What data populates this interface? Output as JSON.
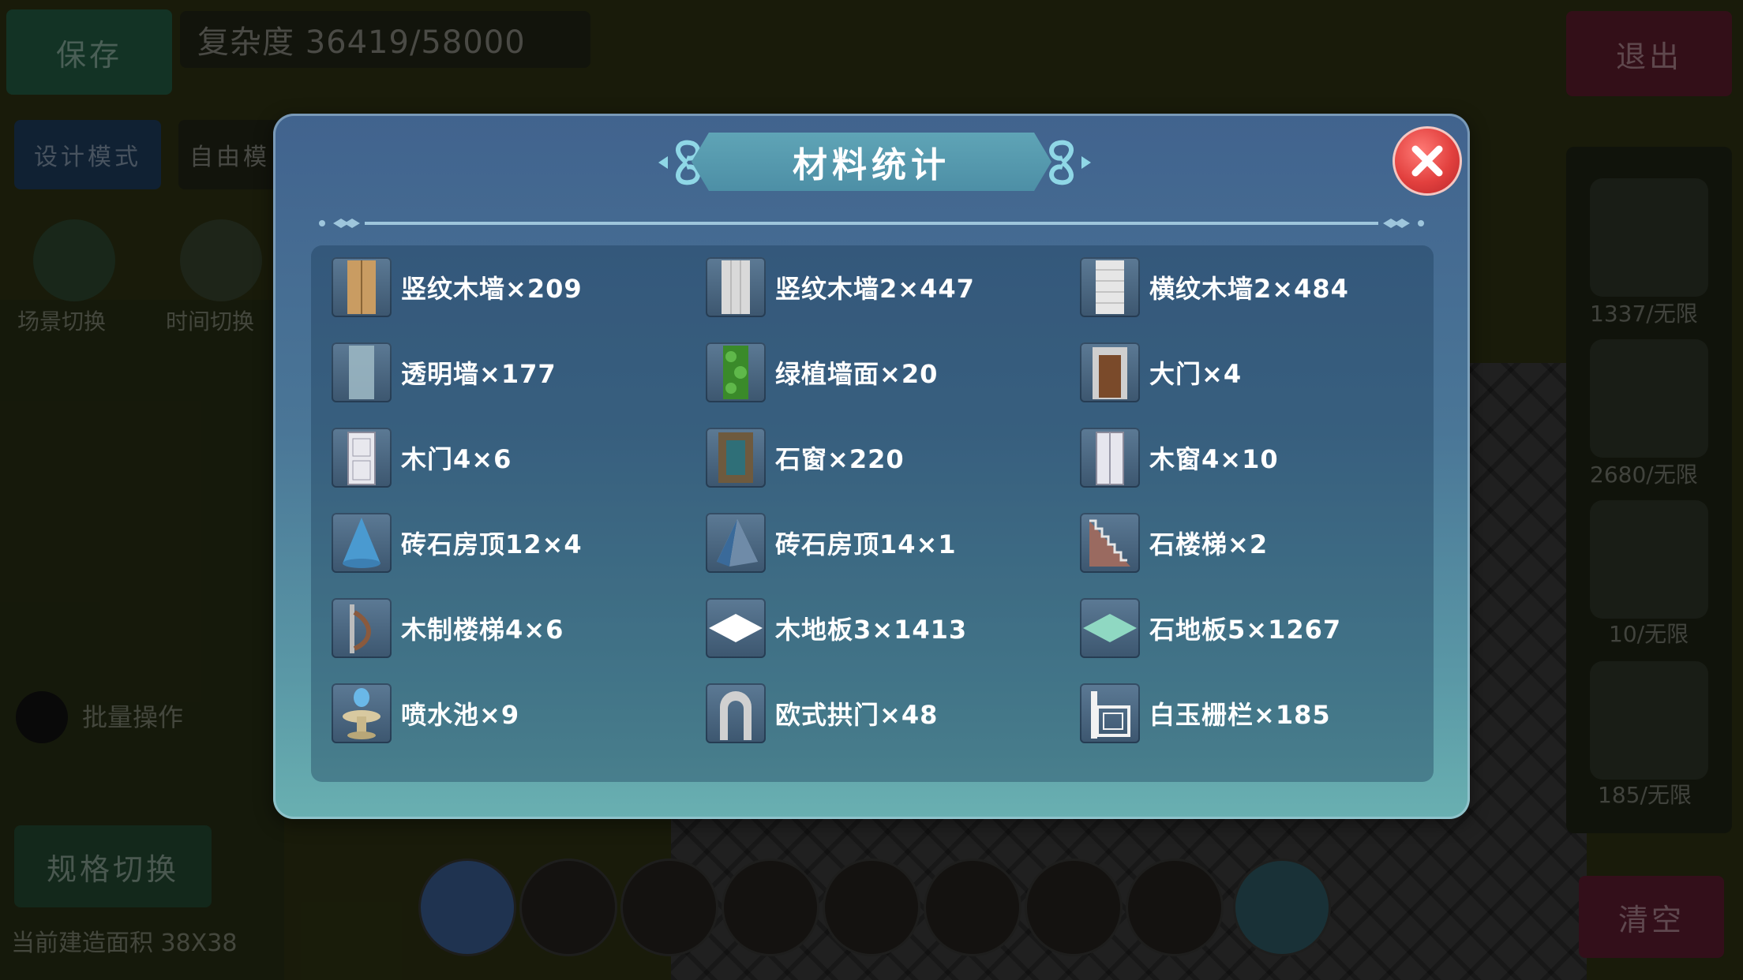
{
  "hud": {
    "save_label": "保存",
    "complexity_label": "复杂度 36419/58000",
    "exit_label": "退出",
    "mode_design_label": "设计模式",
    "mode_free_label": "自由模",
    "scene_switch_label": "场景切换",
    "time_switch_label": "时间切换",
    "batch_label": "批量操作",
    "spec_switch_label": "规格切换",
    "area_label": "当前建造面积 38X38",
    "clear_label": "清空",
    "right_counts": [
      "1337/无限",
      "2680/无限",
      "10/无限",
      "185/无限"
    ]
  },
  "modal": {
    "title": "材料统计",
    "close_icon": "close-x-icon",
    "items": [
      {
        "label": "竖纹木墙×209",
        "icon": "vertical-wood-wall-icon",
        "color": "#c99c62"
      },
      {
        "label": "竖纹木墙2×447",
        "icon": "vertical-wood-wall-2-icon",
        "color": "#d9d9d9"
      },
      {
        "label": "横纹木墙2×484",
        "icon": "horizontal-wood-wall-2-icon",
        "color": "#e6e6e6"
      },
      {
        "label": "透明墙×177",
        "icon": "transparent-wall-icon",
        "color": "#9ab6c2"
      },
      {
        "label": "绿植墙面×20",
        "icon": "green-plant-wall-icon",
        "color": "#3a8a2a"
      },
      {
        "label": "大门×4",
        "icon": "gate-icon",
        "color": "#7a4a2a"
      },
      {
        "label": "木门4×6",
        "icon": "wood-door-icon",
        "color": "#e8e8ee"
      },
      {
        "label": "石窗×220",
        "icon": "stone-window-icon",
        "color": "#6e5a3e"
      },
      {
        "label": "木窗4×10",
        "icon": "wood-window-icon",
        "color": "#e6e6ee"
      },
      {
        "label": "砖石房顶12×4",
        "icon": "cone-roof-icon",
        "color": "#4a9ad0"
      },
      {
        "label": "砖石房顶14×1",
        "icon": "pyramid-roof-icon",
        "color": "#3a6a9a"
      },
      {
        "label": "石楼梯×2",
        "icon": "stone-stairs-icon",
        "color": "#9a6a60"
      },
      {
        "label": "木制楼梯4×6",
        "icon": "wood-stairs-icon",
        "color": "#bcbcbc"
      },
      {
        "label": "木地板3×1413",
        "icon": "wood-floor-tile-icon",
        "color": "#ffffff"
      },
      {
        "label": "石地板5×1267",
        "icon": "stone-floor-tile-icon",
        "color": "#8fd8c2"
      },
      {
        "label": "喷水池×9",
        "icon": "fountain-icon",
        "color": "#6ab8e8"
      },
      {
        "label": "欧式拱门×48",
        "icon": "arch-door-icon",
        "color": "#d0d0d0"
      },
      {
        "label": "白玉栅栏×185",
        "icon": "white-jade-fence-icon",
        "color": "#f2f2f2"
      }
    ]
  }
}
